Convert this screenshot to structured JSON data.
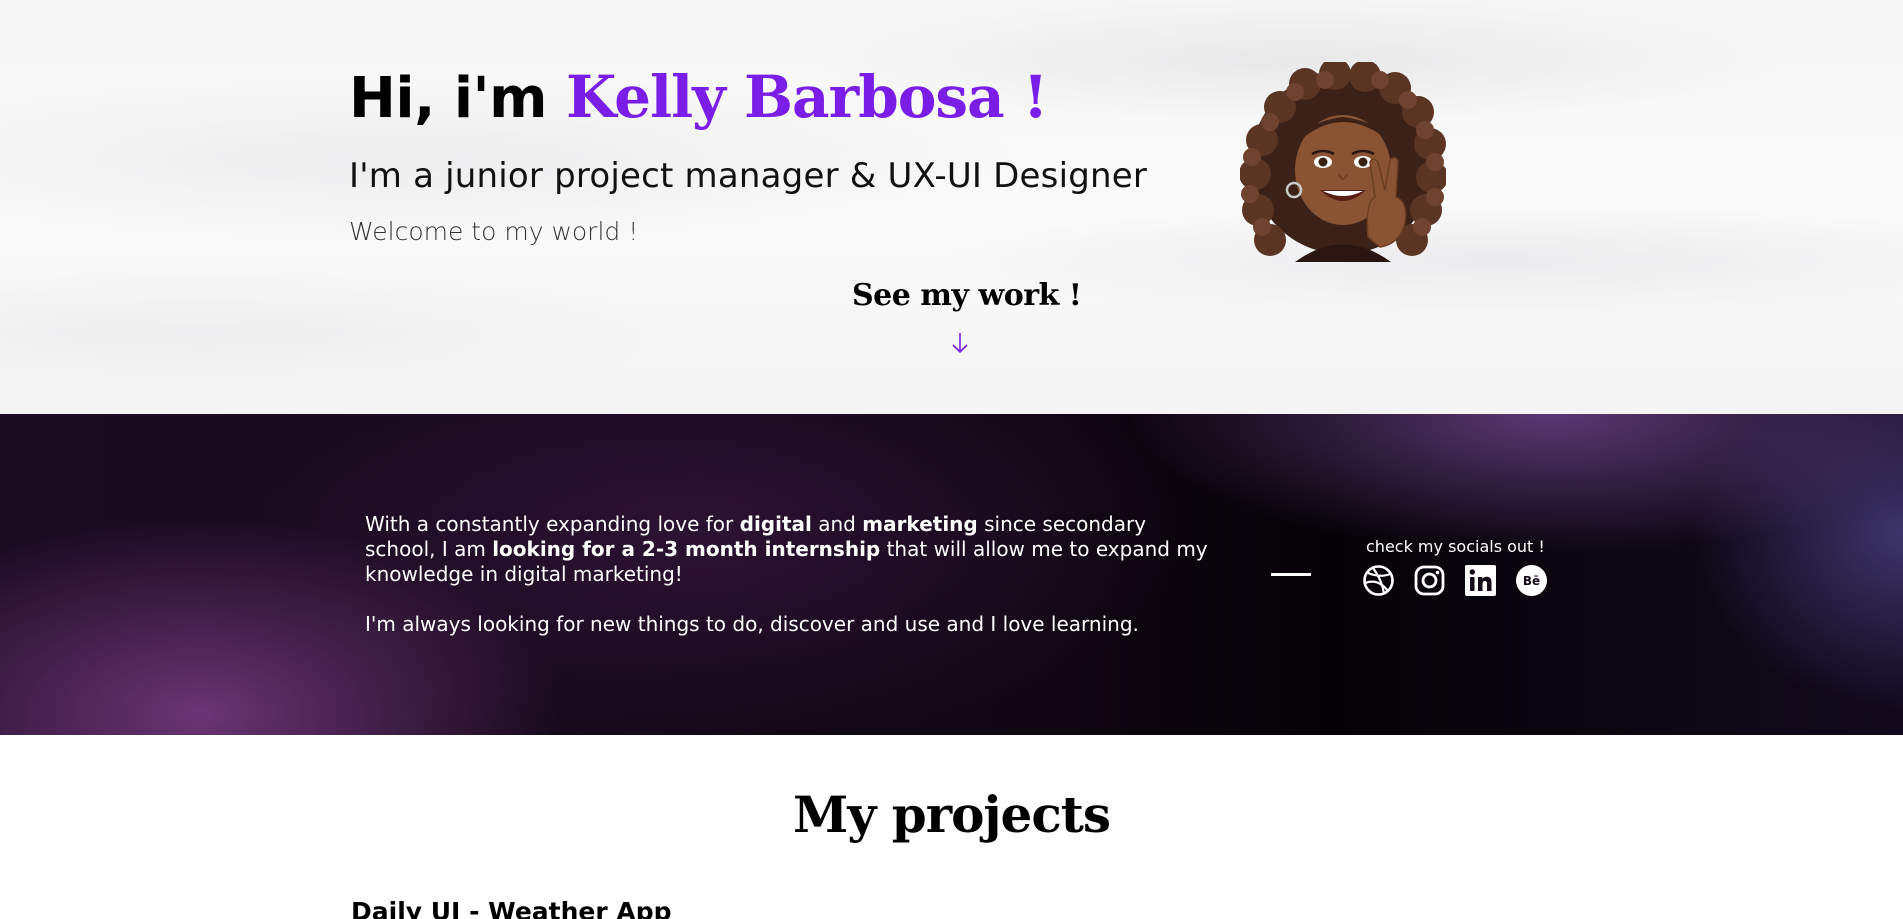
{
  "hero": {
    "greeting": "Hi, i'm ",
    "name": "Kelly Barbosa !",
    "subtitle": "I'm a junior project manager & UX-UI Designer",
    "welcome": "Welcome to my world !",
    "cta": "See my work !",
    "accent_color": "#7a1de6"
  },
  "about": {
    "p1_a": "With a constantly expanding love for ",
    "p1_b": "digital",
    "p1_c": " and ",
    "p1_d": "marketing",
    "p1_e": " since secondary school, I am ",
    "p1_f": "looking for a 2-3 month internship",
    "p1_g": " that will allow me to expand my knowledge in digital marketing!",
    "p2": "I'm always looking for new things to do, discover and use and I love learning."
  },
  "socials": {
    "label": "check my socials out !",
    "items": [
      {
        "name": "dribbble-icon"
      },
      {
        "name": "instagram-icon"
      },
      {
        "name": "linkedin-icon"
      },
      {
        "name": "behance-icon",
        "glyph": "Bē"
      }
    ]
  },
  "projects": {
    "title": "My projects",
    "first_project": "Daily UI - Weather App"
  }
}
